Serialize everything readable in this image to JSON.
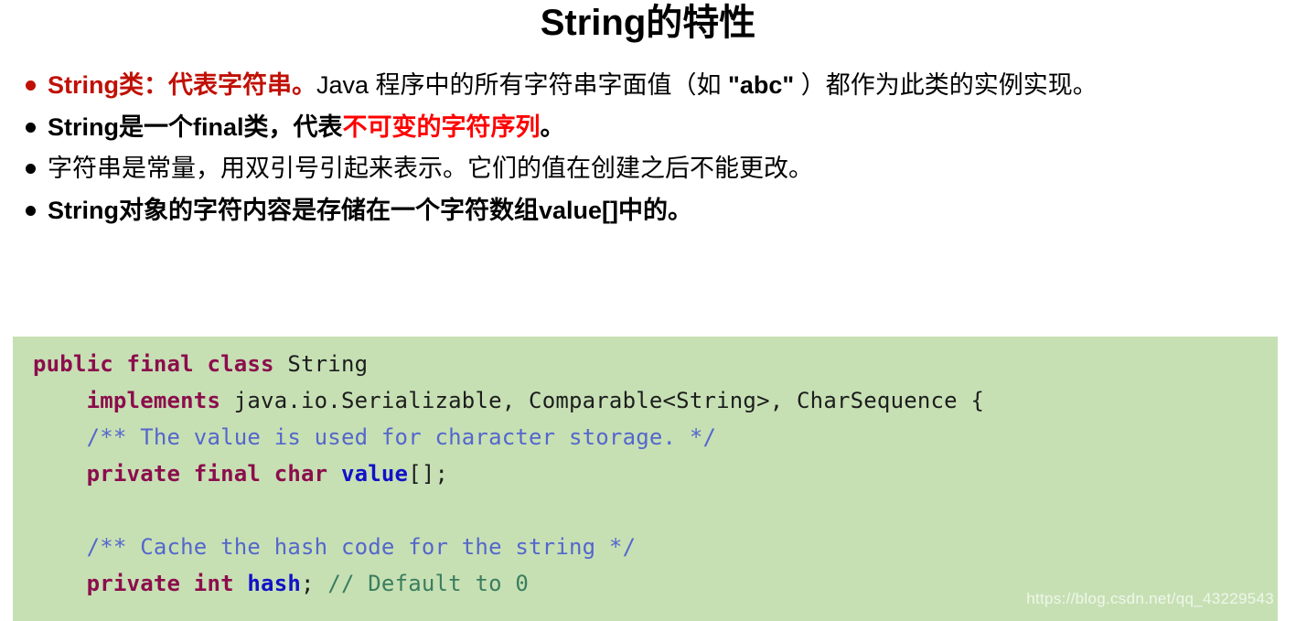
{
  "slide": {
    "title": "String的特性",
    "bullets": [
      {
        "id": "bullet-string-class",
        "marker_color": "#c01005",
        "segments": [
          {
            "text": "String类：代表字符串。",
            "color": "#c01005",
            "bold": true
          },
          {
            "text": "Java 程序中的所有字符串字面值（如 ",
            "color": "#000000",
            "bold": false
          },
          {
            "text": "\"abc\"",
            "color": "#000000",
            "bold": true
          },
          {
            "text": " ）都作为此类的实例实现。",
            "color": "#000000",
            "bold": false
          }
        ]
      },
      {
        "id": "bullet-final-class",
        "marker_color": "#000000",
        "segments": [
          {
            "text": "String是一个final类，代表",
            "color": "#000000",
            "bold": true
          },
          {
            "text": "不可变的字符序列",
            "color": "#ff0000",
            "bold": true
          },
          {
            "text": "。",
            "color": "#000000",
            "bold": true
          }
        ]
      },
      {
        "id": "bullet-constant",
        "marker_color": "#000000",
        "segments": [
          {
            "text": "字符串是常量，用双引号引起来表示。它们的值在创建之后不能更改。",
            "color": "#000000",
            "bold": false
          }
        ]
      },
      {
        "id": "bullet-value-array",
        "marker_color": "#000000",
        "segments": [
          {
            "text": "String对象的字符内容是存储在一个字符数组value[]中的。",
            "color": "#000000",
            "bold": true
          }
        ]
      }
    ]
  },
  "code_block": {
    "background_color": "#c6e0b4",
    "language": "java",
    "colors": {
      "keyword": "#8c0d4c",
      "identifier": "#1d1d1d",
      "variable": "#1111c8",
      "doc_comment": "#5566cc",
      "line_comment": "#3b7d5e"
    },
    "lines": [
      {
        "n": 1,
        "text": "public final class String",
        "tokens": [
          {
            "t": "public final class ",
            "k": "keyword"
          },
          {
            "t": "String",
            "k": "identifier"
          }
        ]
      },
      {
        "n": 2,
        "text": "    implements java.io.Serializable, Comparable<String>, CharSequence {",
        "tokens": [
          {
            "t": "    ",
            "k": "plain"
          },
          {
            "t": "implements",
            "k": "keyword"
          },
          {
            "t": " java.io.Serializable, Comparable<String>, CharSequence {",
            "k": "identifier"
          }
        ]
      },
      {
        "n": 3,
        "text": "    /** The value is used for character storage. */",
        "tokens": [
          {
            "t": "    ",
            "k": "plain"
          },
          {
            "t": "/** The value is used for character storage. */",
            "k": "doc_comment"
          }
        ]
      },
      {
        "n": 4,
        "text": "    private final char value[];",
        "tokens": [
          {
            "t": "    ",
            "k": "plain"
          },
          {
            "t": "private final char ",
            "k": "keyword"
          },
          {
            "t": "value",
            "k": "variable"
          },
          {
            "t": "[];",
            "k": "identifier"
          }
        ]
      },
      {
        "n": 5,
        "text": "",
        "tokens": []
      },
      {
        "n": 6,
        "text": "    /** Cache the hash code for the string */",
        "tokens": [
          {
            "t": "    ",
            "k": "plain"
          },
          {
            "t": "/** Cache the hash code for the string */",
            "k": "doc_comment"
          }
        ]
      },
      {
        "n": 7,
        "text": "    private int hash; // Default to 0",
        "tokens": [
          {
            "t": "    ",
            "k": "plain"
          },
          {
            "t": "private int ",
            "k": "keyword"
          },
          {
            "t": "hash",
            "k": "variable"
          },
          {
            "t": "; ",
            "k": "identifier"
          },
          {
            "t": "// Default to 0",
            "k": "line_comment"
          }
        ]
      }
    ]
  },
  "watermark": {
    "text": "https://blog.csdn.net/qq_43229543"
  }
}
